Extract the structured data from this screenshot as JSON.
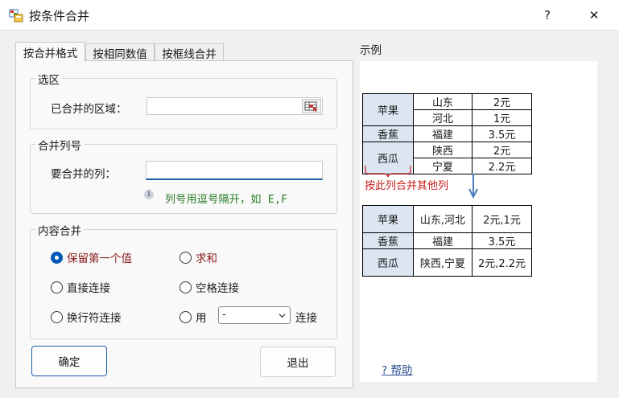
{
  "window": {
    "title": "按条件合并",
    "help_label": "?",
    "close_label": "✕"
  },
  "tabs": [
    {
      "label": "按合并格式",
      "active": true
    },
    {
      "label": "按相同数值",
      "active": false
    },
    {
      "label": "按框线合并",
      "active": false
    }
  ],
  "selection": {
    "legend": "选区",
    "merged_range_label": "已合并的区域：",
    "merged_range_value": ""
  },
  "merge_columns": {
    "legend": "合并列号",
    "columns_label": "要合并的列：",
    "columns_value": "",
    "hint": "列号用逗号隔开，如 E,F"
  },
  "content_merge": {
    "legend": "内容合并",
    "options": [
      {
        "label": "保留第一个值",
        "checked": true
      },
      {
        "label": "求和",
        "checked": false
      },
      {
        "label": "直接连接",
        "checked": false
      },
      {
        "label": "空格连接",
        "checked": false
      },
      {
        "label": "换行符连接",
        "checked": false
      },
      {
        "label": "用",
        "checked": false
      }
    ],
    "separator_value": "-",
    "connect_label": "连接"
  },
  "buttons": {
    "ok_label": "确定",
    "exit_label": "退出"
  },
  "example": {
    "legend": "示例",
    "before": [
      [
        "苹果",
        "山东",
        "2元"
      ],
      [
        "",
        "河北",
        "1元"
      ],
      [
        "香蕉",
        "福建",
        "3.5元"
      ],
      [
        "西瓜",
        "陕西",
        "2元"
      ],
      [
        "",
        "宁夏",
        "2.2元"
      ]
    ],
    "note": "按此列合并其他列",
    "after": [
      [
        "苹果",
        "山东,河北",
        "2元,1元"
      ],
      [
        "香蕉",
        "福建",
        "3.5元"
      ],
      [
        "西瓜",
        "陕西,宁夏",
        "2元,2.2元"
      ]
    ],
    "help_link": "? 帮助"
  },
  "colors": {
    "accent": "#1a5fa8",
    "note_red": "#c81c1c",
    "hint_green": "#217a21"
  }
}
